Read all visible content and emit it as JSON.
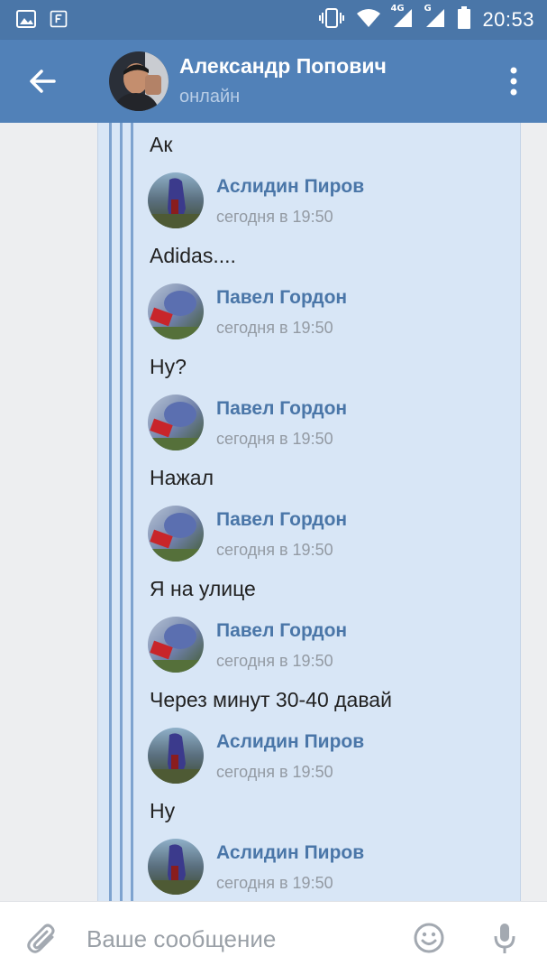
{
  "status_bar": {
    "time": "20:53",
    "network_1": "4G",
    "network_2": "G"
  },
  "header": {
    "contact_name": "Александр Попович",
    "contact_status": "онлайн"
  },
  "messages": [
    {
      "text": "Ак"
    },
    {
      "author": "Аслидин Пиров",
      "time": "сегодня в 19:50",
      "text": "Adidas....",
      "avatar": "aslidin"
    },
    {
      "author": "Павел Гордон",
      "time": "сегодня в 19:50",
      "text": "Ну?",
      "avatar": "pavel"
    },
    {
      "author": "Павел Гордон",
      "time": "сегодня в 19:50",
      "text": "Нажал",
      "avatar": "pavel"
    },
    {
      "author": "Павел Гордон",
      "time": "сегодня в 19:50",
      "text": "Я на улице",
      "avatar": "pavel"
    },
    {
      "author": "Павел Гордон",
      "time": "сегодня в 19:50",
      "text": "Через минут 30-40 давай",
      "avatar": "pavel"
    },
    {
      "author": "Аслидин Пиров",
      "time": "сегодня в 19:50",
      "text": "Ну",
      "avatar": "aslidin"
    },
    {
      "author": "Аслидин Пиров",
      "time": "сегодня в 19:50",
      "avatar": "aslidin"
    }
  ],
  "input": {
    "placeholder": "Ваше сообщение"
  },
  "colors": {
    "header": "#5181b8",
    "status_bar": "#4a76a8",
    "panel": "#d8e6f6",
    "author": "#4a76a8"
  },
  "icons": [
    "image-icon",
    "flipboard-icon",
    "vibrate-icon",
    "wifi-icon",
    "signal-icon",
    "battery-icon",
    "back-arrow-icon",
    "more-vert-icon",
    "attach-icon",
    "emoji-icon",
    "mic-icon"
  ]
}
